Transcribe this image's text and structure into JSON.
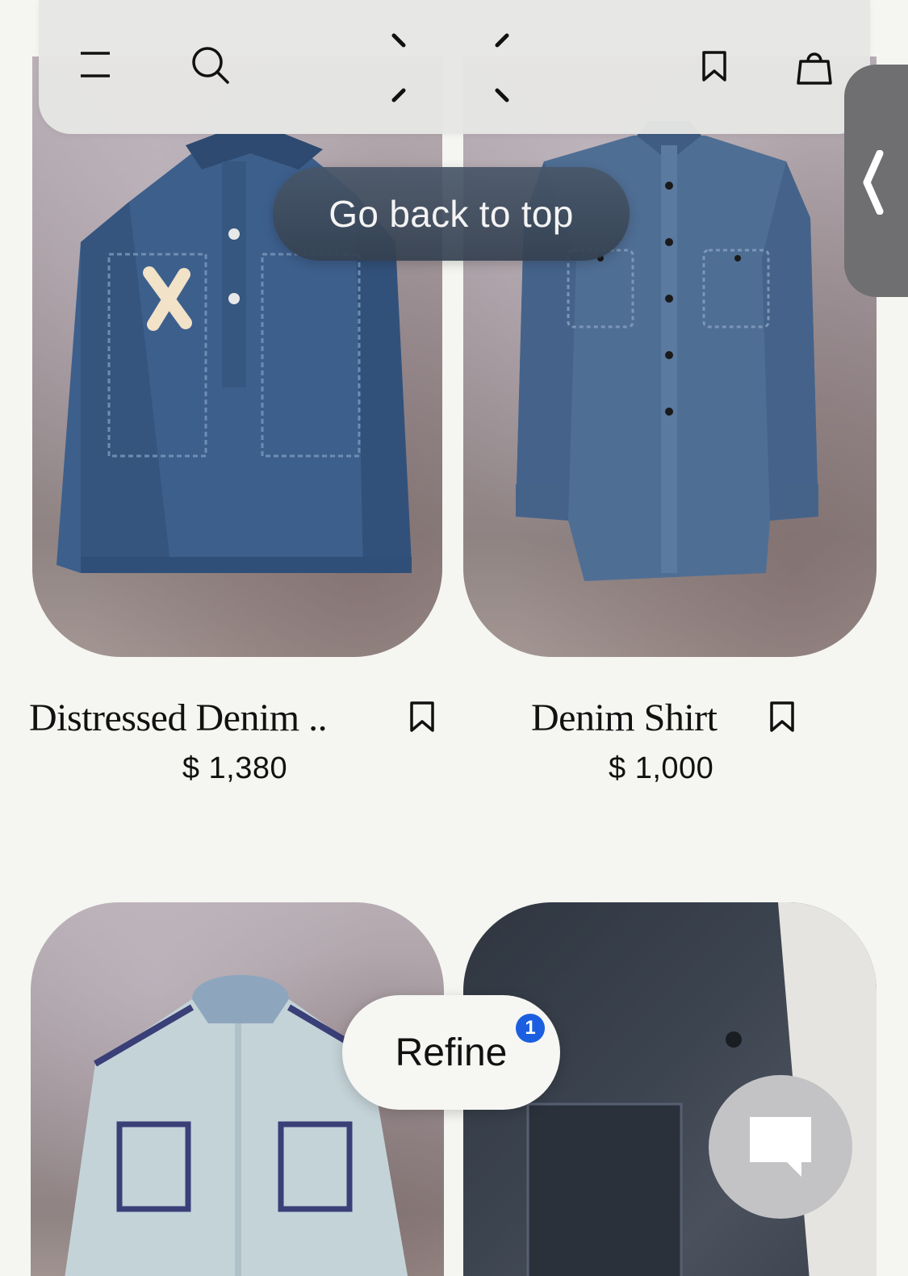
{
  "header": {
    "menu_icon": "menu-icon",
    "search_icon": "search-icon",
    "logo_icon": "logo-stitch-icon",
    "wishlist_icon": "bookmark-icon",
    "bag_icon": "shopping-bag-icon"
  },
  "floating": {
    "back_to_top_label": "Go back to top",
    "refine_label": "Refine",
    "refine_count": "1",
    "side_tab_icon": "chevron-left-icon",
    "chat_icon": "chat-icon"
  },
  "products": [
    {
      "name": "Distressed Denim ..",
      "price": "$ 1,380"
    },
    {
      "name": "Denim Shirt",
      "price": "$ 1,000"
    }
  ],
  "colors": {
    "badge": "#1b5fe0",
    "back_to_top_bg": "#3f4d5e",
    "page_bg": "#f5f5f1"
  }
}
